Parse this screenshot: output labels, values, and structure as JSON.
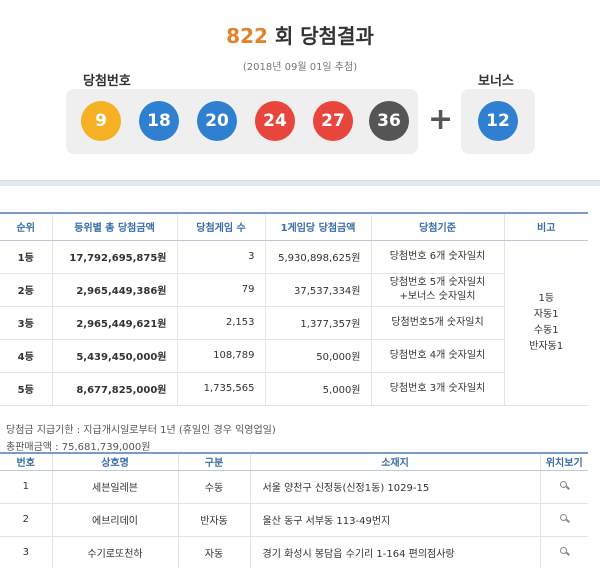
{
  "header": {
    "round": "822",
    "title_suffix": "회 당첨결과",
    "draw_date": "(2018년 09월 01일 추첨)",
    "winning_label": "당첨번호",
    "bonus_label": "보너스"
  },
  "balls": {
    "winning": [
      {
        "number": "9",
        "color": "#f5b024"
      },
      {
        "number": "18",
        "color": "#2f80d1"
      },
      {
        "number": "20",
        "color": "#2f80d1"
      },
      {
        "number": "24",
        "color": "#e8453c"
      },
      {
        "number": "27",
        "color": "#e8453c"
      },
      {
        "number": "36",
        "color": "#555555"
      }
    ],
    "plus": "+",
    "bonus": {
      "number": "12",
      "color": "#2f80d1"
    }
  },
  "prize_table": {
    "headers": [
      "순위",
      "등위별 총 당첨금액",
      "당첨게임 수",
      "1게임당 당첨금액",
      "당첨기준",
      "비고"
    ],
    "rows": [
      {
        "rank": "1등",
        "total": "17,792,695,875원",
        "games": "3",
        "per_game": "5,930,898,625원",
        "criteria_1": "당첨번호 6개 숫자일치",
        "criteria_2": ""
      },
      {
        "rank": "2등",
        "total": "2,965,449,386원",
        "games": "79",
        "per_game": "37,537,334원",
        "criteria_1": "당첨번호 5개 숫자일치",
        "criteria_2": "+보너스 숫자일치"
      },
      {
        "rank": "3등",
        "total": "2,965,449,621원",
        "games": "2,153",
        "per_game": "1,377,357원",
        "criteria_1": "당첨번호5개 숫자일치",
        "criteria_2": ""
      },
      {
        "rank": "4등",
        "total": "5,439,450,000원",
        "games": "108,789",
        "per_game": "50,000원",
        "criteria_1": "당첨번호 4개 숫자일치",
        "criteria_2": ""
      },
      {
        "rank": "5등",
        "total": "8,677,825,000원",
        "games": "1,735,565",
        "per_game": "5,000원",
        "criteria_1": "당첨번호 3개 숫자일치",
        "criteria_2": ""
      }
    ],
    "note_lines": [
      "1등",
      "자동1",
      "수동1",
      "반자동1"
    ]
  },
  "info": {
    "payment_period": "당첨금 지급기한 : 지급개시일로부터 1년 (휴일인 경우 익영업일)",
    "total_sales": "총판매금액 : 75,681,739,000원"
  },
  "store_table": {
    "headers": [
      "번호",
      "상호명",
      "구분",
      "소재지",
      "위치보기"
    ],
    "rows": [
      {
        "no": "1",
        "name": "세븐일레븐",
        "type": "수동",
        "address": "서울 양천구 신정동(신정1동) 1029-15",
        "location_icon": "magnifier-icon"
      },
      {
        "no": "2",
        "name": "에브리데이",
        "type": "반자동",
        "address": "울산 동구 서부동 113-49번지",
        "location_icon": "magnifier-icon"
      },
      {
        "no": "3",
        "name": "수기로또천하",
        "type": "자동",
        "address": "경기 화성시 봉담읍 수기리 1-164 편의점사랑",
        "location_icon": "magnifier-icon"
      }
    ]
  }
}
